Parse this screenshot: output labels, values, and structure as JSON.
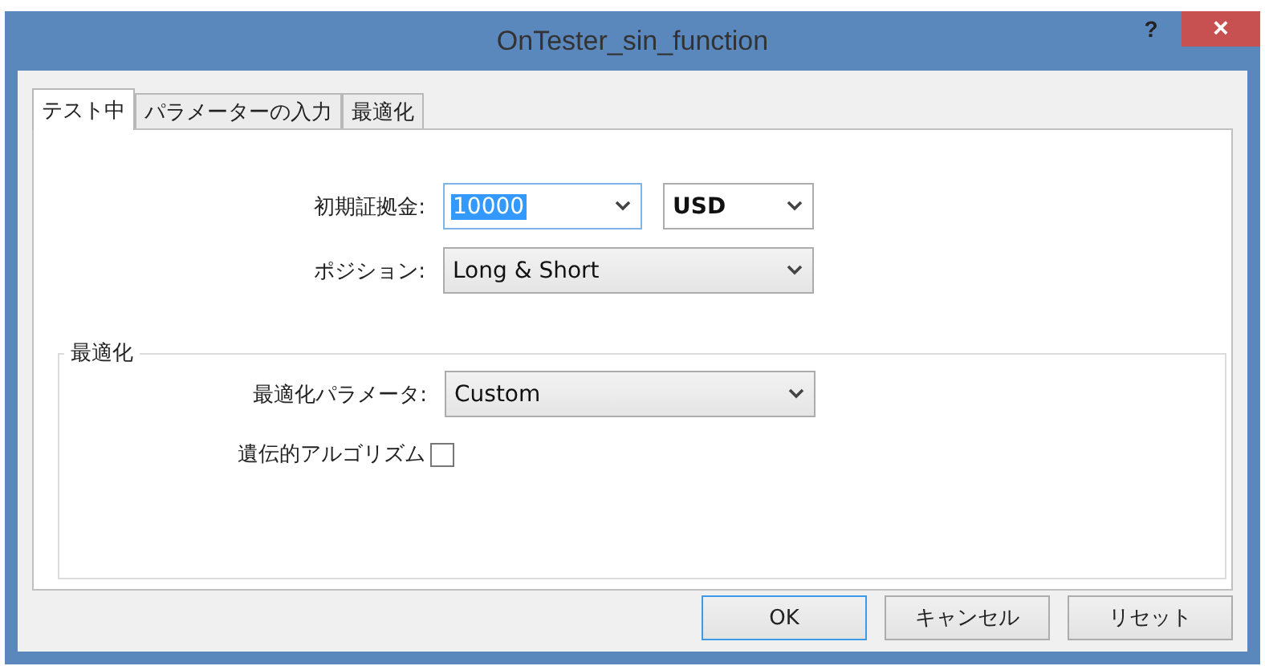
{
  "window": {
    "title": "OnTester_sin_function",
    "help": "?",
    "close": "×"
  },
  "tabs": [
    {
      "label": "テスト中",
      "selected": true
    },
    {
      "label": "パラメーターの入力",
      "selected": false
    },
    {
      "label": "最適化",
      "selected": false
    }
  ],
  "deposit": {
    "label": "初期証拠金:",
    "value": "10000",
    "focused": true,
    "currency": "USD"
  },
  "position": {
    "label": "ポジション:",
    "value": "Long & Short"
  },
  "optimization": {
    "title": "最適化",
    "parameter": {
      "label": "最適化パラメータ:",
      "value": "Custom"
    },
    "genetic": {
      "label": "遺伝的アルゴリズム",
      "checked": false
    }
  },
  "buttons": [
    {
      "label": "OK",
      "default": true
    },
    {
      "label": "キャンセル",
      "default": false
    },
    {
      "label": "リセット",
      "default": false
    }
  ]
}
